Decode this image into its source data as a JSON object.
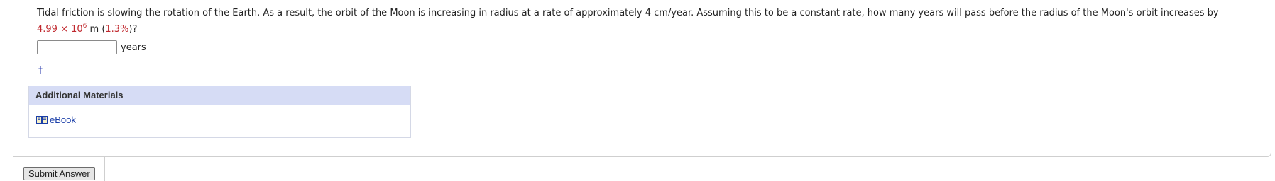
{
  "question": {
    "text": "Tidal friction is slowing the rotation of the Earth. As a result, the orbit of the Moon is increasing in radius at a rate of approximately 4 cm/year. Assuming this to be a constant rate, how many years will pass before the radius of the Moon's orbit increases by",
    "value_mantissa": "4.99 × 10",
    "value_exponent": "6",
    "value_unit": " m (",
    "percent": "1.3%",
    "closing": ")?"
  },
  "answer": {
    "value": "",
    "placeholder": "",
    "unit": "years"
  },
  "footnote_marker": "†",
  "additional_materials": {
    "title": "Additional Materials",
    "ebook_label": "eBook"
  },
  "submit_label": "Submit Answer",
  "colors": {
    "accent_red": "#c0272d",
    "link_blue": "#1a3ea8",
    "materials_header_bg": "#d6dcf5"
  },
  "icons": {
    "ebook": "open-book-icon"
  }
}
